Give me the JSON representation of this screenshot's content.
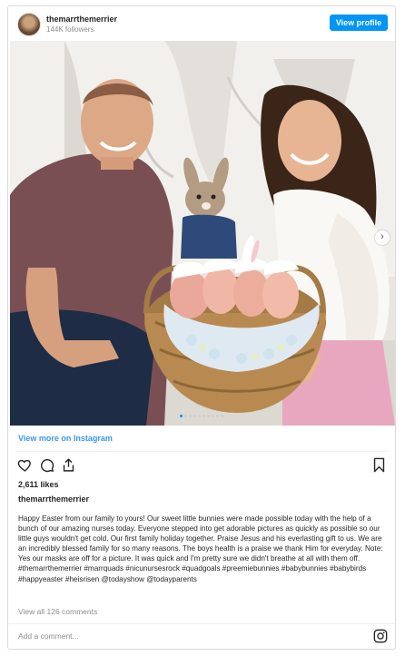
{
  "header": {
    "username": "themarrthemerrier",
    "followers": "144K followers",
    "view_profile_label": "View profile"
  },
  "post": {
    "view_more_label": "View more on Instagram",
    "likes": "2,611 likes",
    "caption_user": "themarrthemerrier",
    "caption_text": "Happy Easter from our family to yours! Our sweet little bunnies were made possible today with the help of a bunch of our amazing nurses today. Everyone stepped into get adorable pictures as quickly as possible so our little guys wouldn't get cold. Our first family holiday together. Praise Jesus and his everlasting gift to us. We are an incredibly blessed family for so many reasons. The boys health is a praise we thank Him for everyday. Note: Yes our masks are off for a picture. It was quick and I'm pretty sure we didn't breathe at all with them off. #themarrthemerrier #marrquads #nicunursesrock #quadgoals #preemiebunnies #babybunnies #babybirds #happyeaster #heisrisen @todayshow @todayparents",
    "view_all_comments": "View all 126 comments",
    "add_comment_placeholder": "Add a comment...",
    "carousel_dots": 10,
    "carousel_active": 0
  },
  "icons": {
    "like": "heart-icon",
    "comment": "comment-icon",
    "share": "share-icon",
    "save": "bookmark-icon",
    "next": "chevron-right-icon",
    "brand": "instagram-icon"
  },
  "colors": {
    "accent": "#0095f6",
    "link": "#3897f0",
    "muted": "#8e8e8e"
  }
}
